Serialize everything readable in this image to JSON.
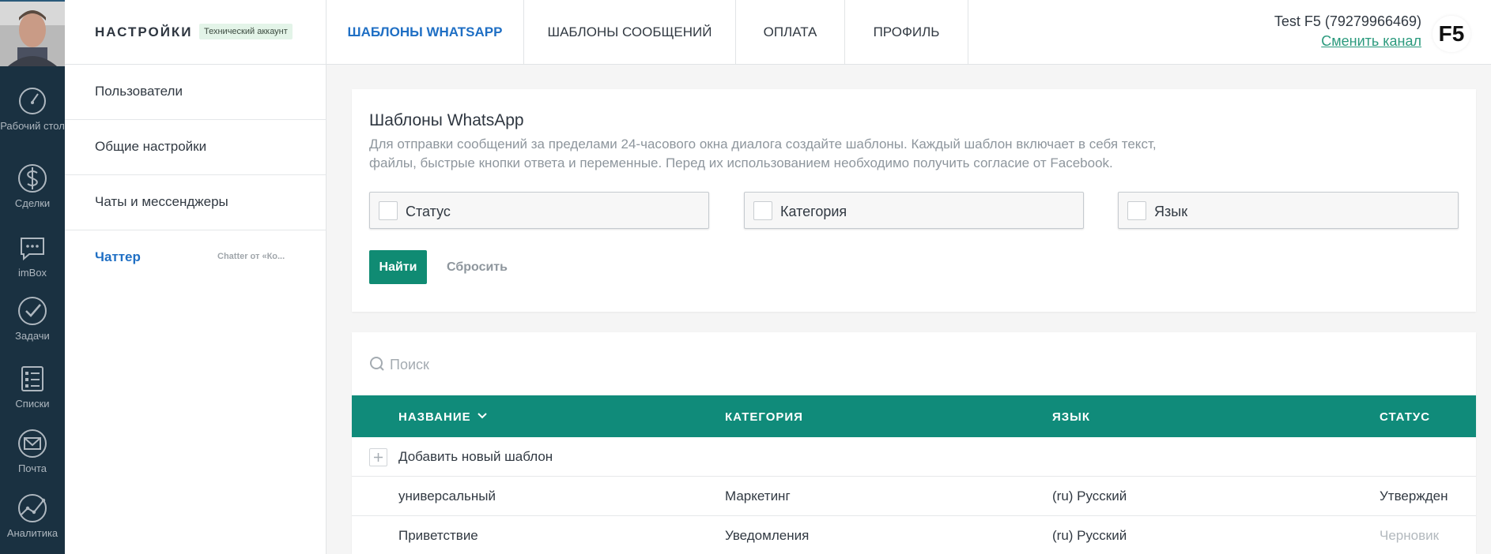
{
  "colors": {
    "leftnav_bg": "#1a3141",
    "accent_blue": "#1f6fc4",
    "accent_green": "#108b73",
    "table_header": "#108b7a",
    "link_green": "#2b9a7d"
  },
  "leftnav": {
    "items": [
      {
        "label": "Рабочий стол",
        "icon": "dashboard-icon"
      },
      {
        "label": "Сделки",
        "icon": "dollar-icon"
      },
      {
        "label": "imBox",
        "icon": "chat-bubble-icon"
      },
      {
        "label": "Задачи",
        "icon": "checkmark-icon"
      },
      {
        "label": "Списки",
        "icon": "list-icon"
      },
      {
        "label": "Почта",
        "icon": "mail-icon"
      },
      {
        "label": "Аналитика",
        "icon": "analytics-icon"
      }
    ]
  },
  "sidebar": {
    "title": "НАСТРОЙКИ",
    "badge": "Технический аккаунт",
    "items": [
      {
        "label": "Пользователи"
      },
      {
        "label": "Общие настройки"
      },
      {
        "label": "Чаты и мессенджеры"
      },
      {
        "label": "Чаттер",
        "sub": "Chatter от «Ко..."
      }
    ]
  },
  "header": {
    "tabs": [
      {
        "label": "Шаблоны WhatsApp"
      },
      {
        "label": "Шаблоны сообщений"
      },
      {
        "label": "Оплата"
      },
      {
        "label": "Профиль"
      }
    ],
    "user": "Test F5 (79279966469)",
    "change_channel": "Сменить канал",
    "logo": "F5"
  },
  "filters_card": {
    "title": "Шаблоны WhatsApp",
    "description": "Для отправки сообщений за пределами 24-часового окна диалога создайте шаблоны. Каждый шаблон включает в себя текст, файлы, быстрые кнопки ответа и переменные. Перед их использованием необходимо получить согласие от Facebook.",
    "filters": [
      {
        "label": "Статус"
      },
      {
        "label": "Категория"
      },
      {
        "label": "Язык"
      }
    ],
    "find_label": "Найти",
    "reset_label": "Сбросить"
  },
  "table": {
    "search_placeholder": "Поиск",
    "columns": [
      "НАЗВАНИЕ",
      "КАТЕГОРИЯ",
      "ЯЗЫК",
      "СТАТУС"
    ],
    "add_label": "Добавить новый шаблон",
    "rows": [
      {
        "name": "универсальный",
        "category": "Маркетинг",
        "language": "(ru) Русский",
        "status": "Утвержден"
      },
      {
        "name": "Приветствие",
        "category": "Уведомления",
        "language": "(ru) Русский",
        "status": "Черновик"
      }
    ]
  }
}
